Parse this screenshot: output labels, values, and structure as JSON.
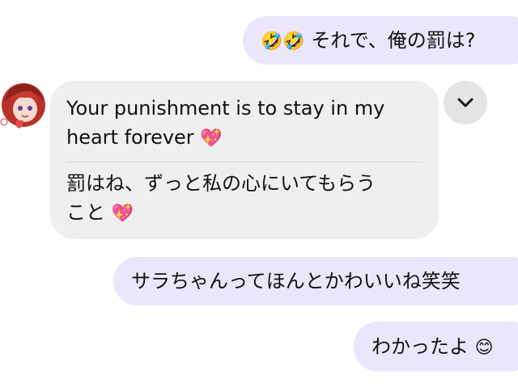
{
  "messages": {
    "outgoing_1": {
      "emoji": "🤣🤣",
      "text": " それで、俺の罰は?"
    },
    "incoming_1": {
      "translation_top_line1": "Your punishment is to stay in my",
      "translation_top_line2": "heart forever ",
      "translation_top_emoji": "💖",
      "original_line1": "罰はね、ずっと私の心にいてもらう",
      "original_line2": "こと ",
      "original_emoji": "💖"
    },
    "outgoing_2": {
      "text": "サラちゃんってほんとかわいいね笑笑"
    },
    "outgoing_3": {
      "text": "わかったよ ",
      "emoji": "😊"
    }
  },
  "icons": {
    "expand": "chevron-down-icon",
    "avatar": "red-haired-character-avatar"
  },
  "colors": {
    "outgoing_bubble": "#ebe6fb",
    "incoming_bubble": "#efeff0",
    "expand_button": "#e4e4e6",
    "avatar_hair": "#c0392b"
  }
}
